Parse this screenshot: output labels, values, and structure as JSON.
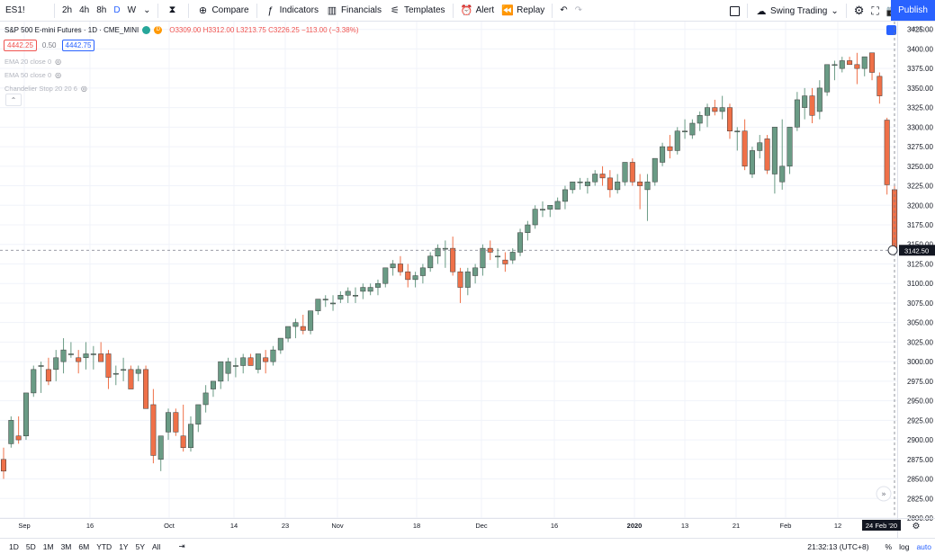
{
  "toolbar": {
    "symbol": "ES1!",
    "intervals": [
      "2h",
      "4h",
      "8h",
      "D",
      "W"
    ],
    "active_interval": "D",
    "compare": "Compare",
    "indicators": "Indicators",
    "financials": "Financials",
    "templates": "Templates",
    "alert": "Alert",
    "replay": "Replay",
    "layout_name": "Swing Trading",
    "publish": "Publish"
  },
  "legend": {
    "title": "S&P 500 E-mini Futures · 1D · CME_MINI",
    "ohlc": "O3309.00  H3312.00  L3213.75  C3226.25  −113.00 (−3.38%)",
    "sell_price": "4442.25",
    "spread": "0.50",
    "buy_price": "4442.75",
    "indicators": [
      "EMA 20 close 0",
      "EMA 50 close 0",
      "Chandelier Stop 20 20 6"
    ]
  },
  "price_axis": {
    "currency": "USD",
    "ticks": [
      3425,
      3400,
      3375,
      3350,
      3325,
      3300,
      3275,
      3250,
      3225,
      3200,
      3175,
      3150,
      3125,
      3100,
      3075,
      3050,
      3025,
      3000,
      2975,
      2950,
      2925,
      2900,
      2875,
      2850,
      2825,
      2800
    ],
    "last_price": "3142.50"
  },
  "time_axis": {
    "labels": [
      "Sep",
      "16",
      "Oct",
      "14",
      "23",
      "Nov",
      "18",
      "Dec",
      "16",
      "2020",
      "13",
      "21",
      "Feb",
      "12"
    ],
    "bold_labels": [
      "2020"
    ],
    "crosshair_date": "24 Feb '20"
  },
  "bottom": {
    "ranges": [
      "1D",
      "5D",
      "1M",
      "3M",
      "6M",
      "YTD",
      "1Y",
      "5Y",
      "All"
    ],
    "time": "21:32:13 (UTC+8)",
    "percent": "%",
    "log": "log",
    "auto": "auto"
  },
  "colors": {
    "up": "#6a9b85",
    "down": "#ef7048",
    "accent": "#2962ff"
  },
  "chart_data": {
    "type": "candlestick",
    "ylim": [
      2800,
      3435
    ],
    "candles": [
      [
        2875,
        2890,
        2850,
        2860
      ],
      [
        2895,
        2930,
        2890,
        2925
      ],
      [
        2905,
        2930,
        2895,
        2900
      ],
      [
        2905,
        2960,
        2900,
        2960
      ],
      [
        2960,
        2995,
        2955,
        2990
      ],
      [
        2995,
        3000,
        2960,
        2995
      ],
      [
        2990,
        3005,
        2970,
        2975
      ],
      [
        2990,
        3015,
        2975,
        3005
      ],
      [
        3000,
        3030,
        2985,
        3015
      ],
      [
        3010,
        3025,
        3005,
        3010
      ],
      [
        3005,
        3015,
        2985,
        3000
      ],
      [
        3005,
        3025,
        2990,
        3010
      ],
      [
        3010,
        3020,
        2990,
        3010
      ],
      [
        3010,
        3025,
        3005,
        3000
      ],
      [
        3010,
        3015,
        2965,
        2980
      ],
      [
        2985,
        2995,
        2970,
        2985
      ],
      [
        2990,
        3005,
        2975,
        2990
      ],
      [
        2990,
        2995,
        2965,
        2965
      ],
      [
        2985,
        2995,
        2975,
        2990
      ],
      [
        2990,
        2995,
        2940,
        2940
      ],
      [
        2945,
        2965,
        2870,
        2880
      ],
      [
        2875,
        2905,
        2860,
        2905
      ],
      [
        2910,
        2940,
        2900,
        2935
      ],
      [
        2935,
        2940,
        2905,
        2910
      ],
      [
        2905,
        2945,
        2885,
        2890
      ],
      [
        2890,
        2930,
        2885,
        2920
      ],
      [
        2920,
        2945,
        2910,
        2945
      ],
      [
        2945,
        2970,
        2935,
        2960
      ],
      [
        2965,
        2975,
        2955,
        2975
      ],
      [
        2975,
        3000,
        2965,
        3000
      ],
      [
        2985,
        3005,
        2975,
        3000
      ],
      [
        2995,
        3005,
        2980,
        2995
      ],
      [
        2995,
        3010,
        2985,
        3005
      ],
      [
        3005,
        3010,
        2995,
        2995
      ],
      [
        2990,
        3010,
        2985,
        3010
      ],
      [
        3005,
        3015,
        2985,
        3000
      ],
      [
        3000,
        3020,
        2995,
        3015
      ],
      [
        3015,
        3030,
        3010,
        3030
      ],
      [
        3030,
        3045,
        3025,
        3045
      ],
      [
        3045,
        3055,
        3030,
        3050
      ],
      [
        3045,
        3060,
        3035,
        3040
      ],
      [
        3040,
        3065,
        3035,
        3065
      ],
      [
        3065,
        3080,
        3060,
        3080
      ],
      [
        3080,
        3085,
        3070,
        3080
      ],
      [
        3075,
        3085,
        3065,
        3075
      ],
      [
        3080,
        3090,
        3075,
        3085
      ],
      [
        3085,
        3095,
        3075,
        3090
      ],
      [
        3085,
        3095,
        3075,
        3085
      ],
      [
        3090,
        3100,
        3080,
        3095
      ],
      [
        3090,
        3100,
        3085,
        3095
      ],
      [
        3095,
        3105,
        3085,
        3100
      ],
      [
        3100,
        3120,
        3095,
        3120
      ],
      [
        3120,
        3130,
        3110,
        3125
      ],
      [
        3125,
        3135,
        3110,
        3115
      ],
      [
        3115,
        3125,
        3095,
        3105
      ],
      [
        3105,
        3115,
        3095,
        3110
      ],
      [
        3110,
        3125,
        3100,
        3120
      ],
      [
        3120,
        3140,
        3115,
        3135
      ],
      [
        3135,
        3150,
        3125,
        3145
      ],
      [
        3145,
        3155,
        3120,
        3145
      ],
      [
        3145,
        3160,
        3110,
        3115
      ],
      [
        3115,
        3120,
        3075,
        3095
      ],
      [
        3095,
        3120,
        3085,
        3115
      ],
      [
        3110,
        3125,
        3100,
        3120
      ],
      [
        3120,
        3150,
        3110,
        3145
      ],
      [
        3145,
        3155,
        3130,
        3140
      ],
      [
        3135,
        3145,
        3120,
        3135
      ],
      [
        3130,
        3140,
        3115,
        3125
      ],
      [
        3130,
        3145,
        3125,
        3140
      ],
      [
        3140,
        3170,
        3135,
        3165
      ],
      [
        3165,
        3180,
        3155,
        3175
      ],
      [
        3175,
        3200,
        3170,
        3195
      ],
      [
        3195,
        3205,
        3185,
        3195
      ],
      [
        3195,
        3200,
        3185,
        3200
      ],
      [
        3195,
        3210,
        3195,
        3205
      ],
      [
        3205,
        3225,
        3195,
        3220
      ],
      [
        3220,
        3230,
        3215,
        3230
      ],
      [
        3230,
        3235,
        3220,
        3230
      ],
      [
        3225,
        3235,
        3215,
        3230
      ],
      [
        3230,
        3245,
        3225,
        3240
      ],
      [
        3240,
        3250,
        3225,
        3235
      ],
      [
        3235,
        3245,
        3210,
        3220
      ],
      [
        3220,
        3240,
        3215,
        3230
      ],
      [
        3230,
        3255,
        3225,
        3255
      ],
      [
        3255,
        3260,
        3225,
        3230
      ],
      [
        3230,
        3240,
        3195,
        3225
      ],
      [
        3220,
        3240,
        3180,
        3230
      ],
      [
        3230,
        3260,
        3225,
        3260
      ],
      [
        3255,
        3280,
        3250,
        3275
      ],
      [
        3275,
        3290,
        3260,
        3270
      ],
      [
        3270,
        3300,
        3265,
        3295
      ],
      [
        3295,
        3310,
        3285,
        3295
      ],
      [
        3290,
        3310,
        3285,
        3305
      ],
      [
        3305,
        3320,
        3295,
        3315
      ],
      [
        3315,
        3330,
        3300,
        3325
      ],
      [
        3325,
        3335,
        3315,
        3320
      ],
      [
        3320,
        3340,
        3310,
        3325
      ],
      [
        3325,
        3330,
        3285,
        3295
      ],
      [
        3295,
        3300,
        3270,
        3295
      ],
      [
        3295,
        3310,
        3245,
        3250
      ],
      [
        3240,
        3275,
        3235,
        3270
      ],
      [
        3270,
        3290,
        3260,
        3280
      ],
      [
        3285,
        3290,
        3240,
        3245
      ],
      [
        3240,
        3290,
        3215,
        3300
      ],
      [
        3230,
        3310,
        3220,
        3250
      ],
      [
        3250,
        3300,
        3240,
        3300
      ],
      [
        3300,
        3345,
        3295,
        3335
      ],
      [
        3325,
        3350,
        3310,
        3340
      ],
      [
        3340,
        3350,
        3305,
        3315
      ],
      [
        3320,
        3360,
        3310,
        3350
      ],
      [
        3345,
        3380,
        3340,
        3380
      ],
      [
        3380,
        3385,
        3360,
        3380
      ],
      [
        3375,
        3390,
        3370,
        3385
      ],
      [
        3385,
        3390,
        3380,
        3380
      ],
      [
        3380,
        3395,
        3355,
        3375
      ],
      [
        3375,
        3390,
        3365,
        3390
      ],
      [
        3395,
        3395,
        3360,
        3370
      ],
      [
        3365,
        3370,
        3330,
        3340
      ],
      [
        3309,
        3312,
        3213.75,
        3226.25
      ],
      [
        3220,
        3225,
        3140,
        3142.5
      ]
    ]
  }
}
